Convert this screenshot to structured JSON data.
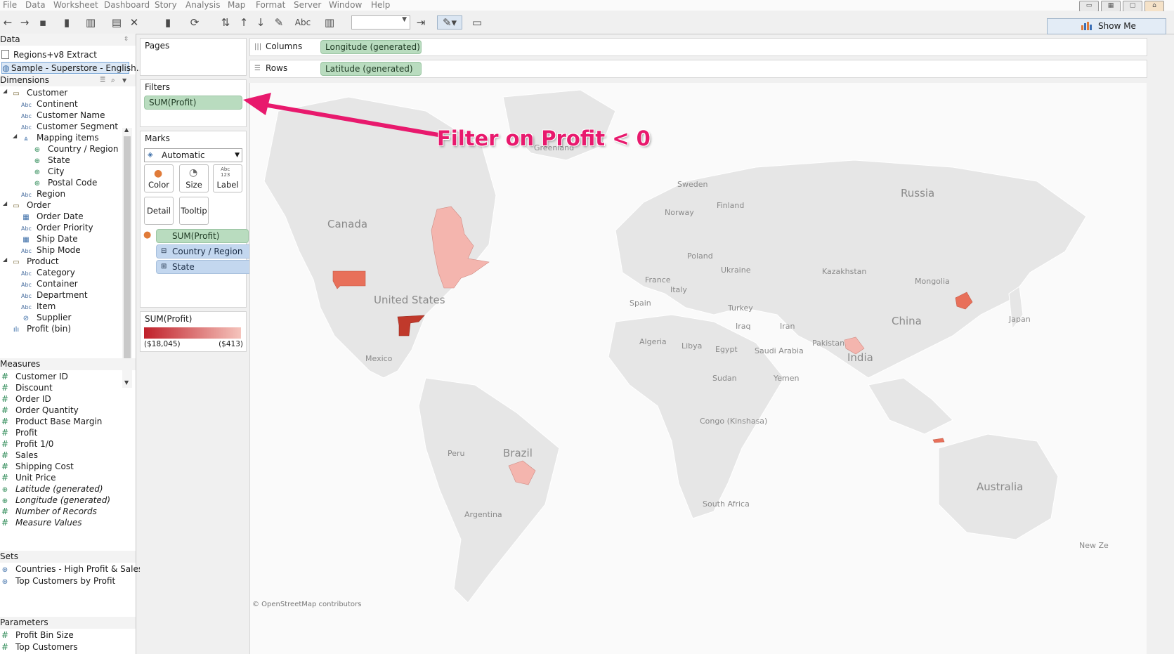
{
  "menu": [
    "File",
    "Data",
    "Worksheet",
    "Dashboard",
    "Story",
    "Analysis",
    "Map",
    "Format",
    "Server",
    "Window",
    "Help"
  ],
  "toolbar": {
    "abc_label": "Abc",
    "show_me_label": "Show Me"
  },
  "data_pane": {
    "header": "Data",
    "sources": [
      "Regions+v8 Extract",
      "Sample - Superstore - English..."
    ],
    "dimensions_header": "Dimensions",
    "dimensions": [
      {
        "label": "Customer",
        "type": "folder",
        "level": 1
      },
      {
        "label": "Continent",
        "type": "abc",
        "level": 2
      },
      {
        "label": "Customer Name",
        "type": "abc",
        "level": 2
      },
      {
        "label": "Customer Segment",
        "type": "abc",
        "level": 2
      },
      {
        "label": "Mapping items",
        "type": "hierarchy",
        "level": 2
      },
      {
        "label": "Country / Region",
        "type": "globe",
        "level": 3
      },
      {
        "label": "State",
        "type": "globe",
        "level": 3
      },
      {
        "label": "City",
        "type": "globe",
        "level": 3
      },
      {
        "label": "Postal Code",
        "type": "globe",
        "level": 3
      },
      {
        "label": "Region",
        "type": "abc",
        "level": 2
      },
      {
        "label": "Order",
        "type": "folder",
        "level": 1
      },
      {
        "label": "Order Date",
        "type": "date",
        "level": 2
      },
      {
        "label": "Order Priority",
        "type": "abc",
        "level": 2
      },
      {
        "label": "Ship Date",
        "type": "date",
        "level": 2
      },
      {
        "label": "Ship Mode",
        "type": "abc",
        "level": 2
      },
      {
        "label": "Product",
        "type": "folder",
        "level": 1
      },
      {
        "label": "Category",
        "type": "abc",
        "level": 2
      },
      {
        "label": "Container",
        "type": "abc",
        "level": 2
      },
      {
        "label": "Department",
        "type": "abc",
        "level": 2
      },
      {
        "label": "Item",
        "type": "abc",
        "level": 2
      },
      {
        "label": "Supplier",
        "type": "link",
        "level": 2
      },
      {
        "label": "Profit (bin)",
        "type": "bin",
        "level": 1
      }
    ],
    "measures_header": "Measures",
    "measures": [
      {
        "label": "Customer ID",
        "italic": false
      },
      {
        "label": "Discount",
        "italic": false
      },
      {
        "label": "Order ID",
        "italic": false
      },
      {
        "label": "Order Quantity",
        "italic": false
      },
      {
        "label": "Product Base Margin",
        "italic": false
      },
      {
        "label": "Profit",
        "italic": false
      },
      {
        "label": "Profit 1/0",
        "italic": false
      },
      {
        "label": "Sales",
        "italic": false
      },
      {
        "label": "Shipping Cost",
        "italic": false
      },
      {
        "label": "Unit Price",
        "italic": false
      },
      {
        "label": "Latitude (generated)",
        "italic": true
      },
      {
        "label": "Longitude (generated)",
        "italic": true
      },
      {
        "label": "Number of Records",
        "italic": true
      },
      {
        "label": "Measure Values",
        "italic": true
      }
    ],
    "sets_header": "Sets",
    "sets": [
      "Countries - High Profit & Sales",
      "Top Customers by Profit"
    ],
    "parameters_header": "Parameters",
    "parameters": [
      "Profit Bin Size",
      "Top Customers"
    ]
  },
  "shelves": {
    "pages_title": "Pages",
    "filters_title": "Filters",
    "filter_pill": "SUM(Profit)",
    "marks_title": "Marks",
    "mark_type": "Automatic",
    "mark_buttons": [
      "Color",
      "Size",
      "Label",
      "Detail",
      "Tooltip"
    ],
    "label_icon_text": "Abc\n123",
    "mark_pills": [
      "SUM(Profit)",
      "Country / Region",
      "State"
    ],
    "legend_title": "SUM(Profit)",
    "legend_min": "($18,045)",
    "legend_max": "($413)",
    "columns_label": "Columns",
    "columns_pill": "Longitude (generated)",
    "rows_label": "Rows",
    "rows_pill": "Latitude (generated)"
  },
  "map": {
    "labels": [
      "Greenland",
      "Canada",
      "United States",
      "Mexico",
      "Brazil",
      "Peru",
      "Argentina",
      "Sweden",
      "Finland",
      "Norway",
      "Russia",
      "Poland",
      "Ukraine",
      "France",
      "Italy",
      "Spain",
      "Turkey",
      "Kazakhstan",
      "Mongolia",
      "China",
      "Japan",
      "Iraq",
      "Iran",
      "Pakistan",
      "India",
      "Algeria",
      "Libya",
      "Egypt",
      "Saudi Arabia",
      "Yemen",
      "Sudan",
      "Congo (Kinshasa)",
      "South Africa",
      "Australia",
      "New Ze"
    ],
    "attribution": "© OpenStreetMap contributors",
    "colors": {
      "land": "#e6e6e6",
      "border": "#ffffff",
      "dark": "#c0392b",
      "mid": "#e8705a",
      "light": "#f4b5ae"
    }
  },
  "annotation": {
    "text": "Filter on Profit < 0",
    "color": "#e8196d"
  }
}
